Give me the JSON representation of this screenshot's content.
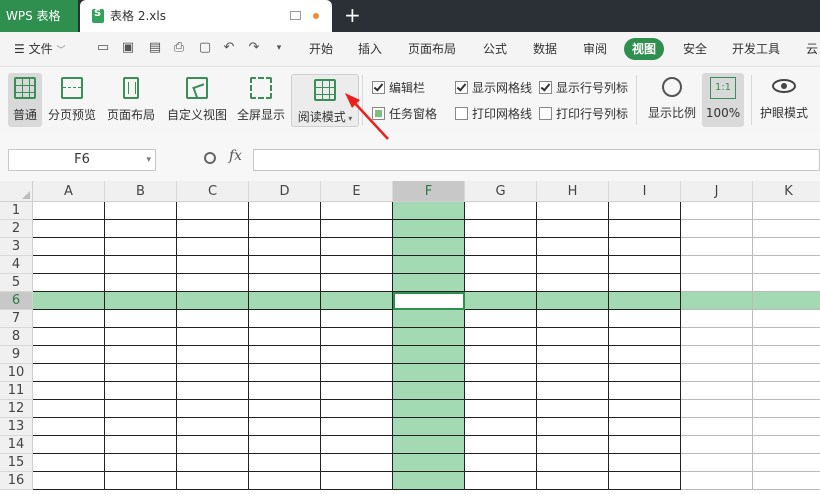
{
  "titlebar": {
    "app_name": "WPS 表格",
    "doc_name": "表格 2.xls",
    "new_tab": "+"
  },
  "menu": {
    "file_label": "文件",
    "items": [
      "开始",
      "插入",
      "页面布局",
      "公式",
      "数据",
      "审阅",
      "视图",
      "安全",
      "开发工具",
      "云"
    ],
    "active_index": 6
  },
  "ribbon": {
    "views": [
      {
        "label": "普通",
        "icon": "grid-icon"
      },
      {
        "label": "分页预览",
        "icon": "page-break-icon"
      },
      {
        "label": "页面布局",
        "icon": "page-layout-icon"
      },
      {
        "label": "自定义视图",
        "icon": "custom-view-icon"
      },
      {
        "label": "全屏显示",
        "icon": "fullscreen-icon"
      },
      {
        "label": "阅读模式",
        "icon": "reading-mode-icon"
      }
    ],
    "options": [
      {
        "label": "编辑栏",
        "checked": true
      },
      {
        "label": "任务窗格",
        "checked": true
      },
      {
        "label": "显示网格线",
        "checked": true
      },
      {
        "label": "打印网格线",
        "checked": false
      },
      {
        "label": "显示行号列标",
        "checked": true
      },
      {
        "label": "打印行号列标",
        "checked": false
      }
    ],
    "zoom_label": "显示比例",
    "zoom_value": "100%",
    "zoom_icon_text": "1:1",
    "eye_label": "护眼模式"
  },
  "formula_bar": {
    "cell_ref": "F6",
    "fx": "fx",
    "formula": ""
  },
  "sheet": {
    "columns": [
      "A",
      "B",
      "C",
      "D",
      "E",
      "F",
      "G",
      "H",
      "I",
      "J",
      "K"
    ],
    "rows": [
      "1",
      "2",
      "3",
      "4",
      "5",
      "6",
      "7",
      "8",
      "9",
      "10",
      "11",
      "12",
      "13",
      "14",
      "15",
      "16"
    ],
    "selected_col": "F",
    "selected_row": "6"
  },
  "colors": {
    "accent": "#2f8f4e",
    "highlight": "#a3dab3",
    "arrow": "#e8211f"
  }
}
